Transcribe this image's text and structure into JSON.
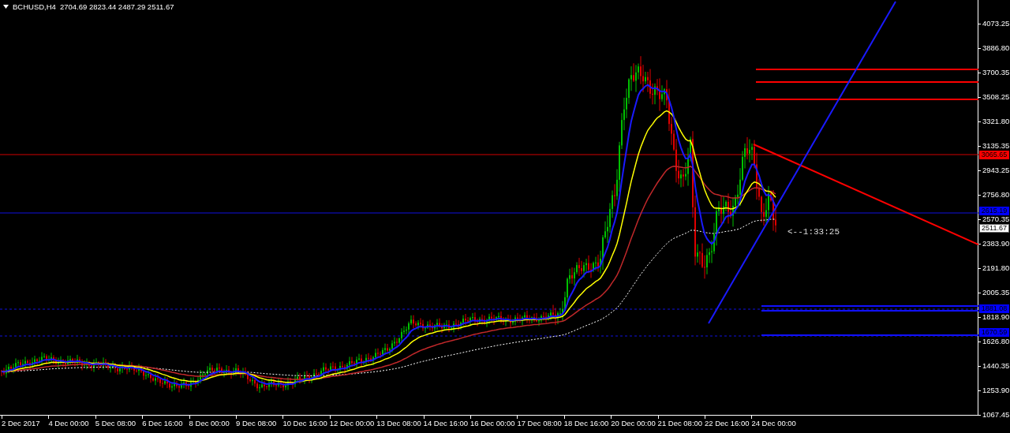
{
  "chart": {
    "symbol": "BCHUSD,H4",
    "ohlc": "2704.69 2823.44 2487.29 2511.67",
    "countdown": "<--1:33:25",
    "price_ticks": [
      "4073.25",
      "3886.80",
      "3700.35",
      "3508.25",
      "3321.80",
      "3135.35",
      "2943.25",
      "2756.80",
      "2570.35",
      "2383.90",
      "2191.80",
      "2005.35",
      "1818.90",
      "1626.80",
      "1440.35",
      "1253.90",
      "1067.45"
    ],
    "price_labels": [
      {
        "text": "3065.65",
        "kind": "level",
        "color": "#ff0000"
      },
      {
        "text": "2615.19",
        "kind": "level",
        "color": "#0000ff"
      },
      {
        "text": "2511.67",
        "kind": "bid",
        "color": "#ffffff"
      },
      {
        "text": "1881.08",
        "kind": "level",
        "color": "#0000ff"
      },
      {
        "text": "1670.59",
        "kind": "level",
        "color": "#0000ff"
      }
    ],
    "time_labels": [
      "2 Dec 2017",
      "4 Dec 00:00",
      "5 Dec 08:00",
      "6 Dec 16:00",
      "8 Dec 00:00",
      "9 Dec 08:00",
      "10 Dec 16:00",
      "12 Dec 00:00",
      "13 Dec 08:00",
      "14 Dec 16:00",
      "16 Dec 00:00",
      "17 Dec 08:00",
      "18 Dec 16:00",
      "20 Dec 00:00",
      "21 Dec 08:00",
      "22 Dec 16:00",
      "24 Dec 00:00"
    ]
  }
}
